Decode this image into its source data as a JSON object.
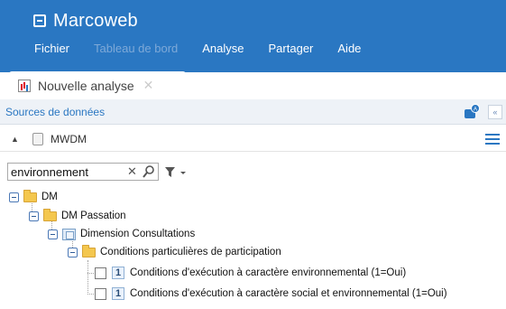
{
  "app": {
    "title": "Marcoweb"
  },
  "menu": {
    "items": [
      {
        "label": "Fichier",
        "disabled": false
      },
      {
        "label": "Tableau de bord",
        "disabled": true
      },
      {
        "label": "Analyse",
        "disabled": false
      },
      {
        "label": "Partager",
        "disabled": false
      },
      {
        "label": "Aide",
        "disabled": false
      }
    ]
  },
  "tab": {
    "label": "Nouvelle analyse",
    "close": "✕"
  },
  "sources": {
    "label": "Sources de données",
    "collapse": "«"
  },
  "datasource": {
    "label": "MWDM",
    "expand": "▲"
  },
  "search": {
    "value": "environnement",
    "clear": "✕"
  },
  "tree": {
    "root": "DM",
    "passation": "DM Passation",
    "dimension": "Dimension Consultations",
    "folder": "Conditions particulières de participation",
    "leaves": [
      {
        "num": "1",
        "label": "Conditions d'exécution à caractère environnemental (1=Oui)"
      },
      {
        "num": "1",
        "label": "Conditions d'exécution à caractère social et environnemental (1=Oui)"
      }
    ]
  },
  "colors": {
    "header": "#2a77c2",
    "accent": "#2a77c2",
    "folder": "#f4c74e"
  }
}
